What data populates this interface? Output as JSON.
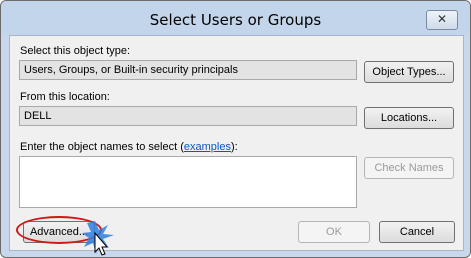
{
  "window": {
    "title": "Select Users or Groups",
    "close_glyph": "✕"
  },
  "object_type": {
    "label": "Select this object type:",
    "value": "Users, Groups, or Built-in security principals",
    "button": "Object Types..."
  },
  "location": {
    "label": "From this location:",
    "value": "DELL",
    "button": "Locations..."
  },
  "object_names": {
    "label_part1": "Enter the object names to select (",
    "label_link": "examples",
    "label_part2": "):",
    "value": "",
    "check_names_button": "Check Names"
  },
  "footer": {
    "advanced_button": "Advanced...",
    "ok_button": "OK",
    "cancel_button": "Cancel"
  },
  "annotation": {
    "ring_color": "#d01818",
    "cursor_glow_color": "#2f7fe0"
  }
}
